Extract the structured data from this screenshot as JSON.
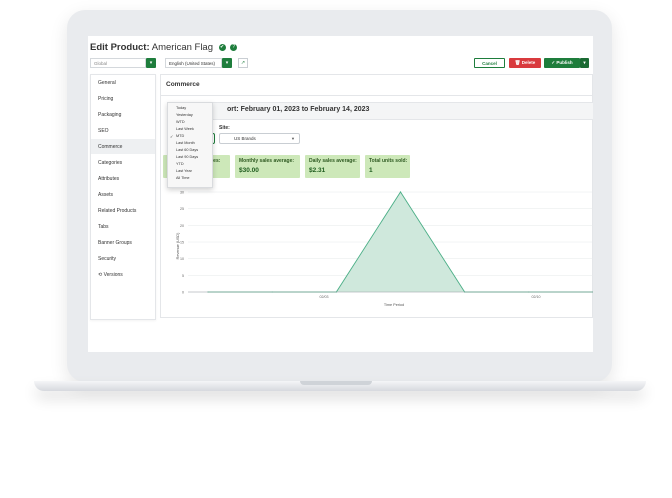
{
  "header": {
    "title_prefix": "Edit Product:",
    "title_name": " American Flag",
    "check_icon": "✔",
    "help_icon": "?"
  },
  "toolbar": {
    "scope_value": "Global",
    "locale_value": "English (United States)",
    "cancel_label": "Cancel",
    "delete_label": "Delete",
    "publish_label": "Publish",
    "colors": {
      "primary": "#1e7d3c",
      "danger": "#d93a3e"
    }
  },
  "sidebar": {
    "items": [
      {
        "label": "General"
      },
      {
        "label": "Pricing"
      },
      {
        "label": "Packaging"
      },
      {
        "label": "SEO"
      },
      {
        "label": "Commerce"
      },
      {
        "label": "Categories"
      },
      {
        "label": "Attributes"
      },
      {
        "label": "Assets"
      },
      {
        "label": "Related Products"
      },
      {
        "label": "Tabs"
      },
      {
        "label": "Banner Groups"
      },
      {
        "label": "Security"
      },
      {
        "label": "Versions"
      }
    ],
    "active": "Commerce"
  },
  "main": {
    "section_title": "Commerce",
    "report_title": "ort: February 01, 2023 to February 14, 2023",
    "site_label": "Site:",
    "site_value": "US Brands"
  },
  "date_range_menu": {
    "options": [
      "Today",
      "Yesterday",
      "WTD",
      "Last Week",
      "MTD",
      "Last Month",
      "Last 60 Days",
      "Last 90 Days",
      "YTD",
      "Last Year",
      "All Time"
    ],
    "selected": "MTD",
    "check_mark": "✓"
  },
  "stats": [
    {
      "label": "ales:",
      "value": ""
    },
    {
      "label": "Monthly sales average:",
      "value": "$30.00"
    },
    {
      "label": "Daily sales average:",
      "value": "$2.31"
    },
    {
      "label": "Total units sold:",
      "value": "1"
    }
  ],
  "chart_data": {
    "type": "area",
    "title": "",
    "xlabel": "Time Period",
    "ylabel": "Revenue (USD)",
    "x": [
      "",
      "",
      "",
      "",
      "",
      "",
      ""
    ],
    "x_tick_labels": [
      "02/03",
      "02/10"
    ],
    "y_ticks": [
      0,
      5,
      10,
      15,
      20,
      25,
      30
    ],
    "ylim": [
      0,
      30
    ],
    "series": [
      {
        "values": [
          0,
          0,
          0,
          30,
          0,
          0,
          0
        ],
        "color": "#4caf87"
      }
    ]
  }
}
